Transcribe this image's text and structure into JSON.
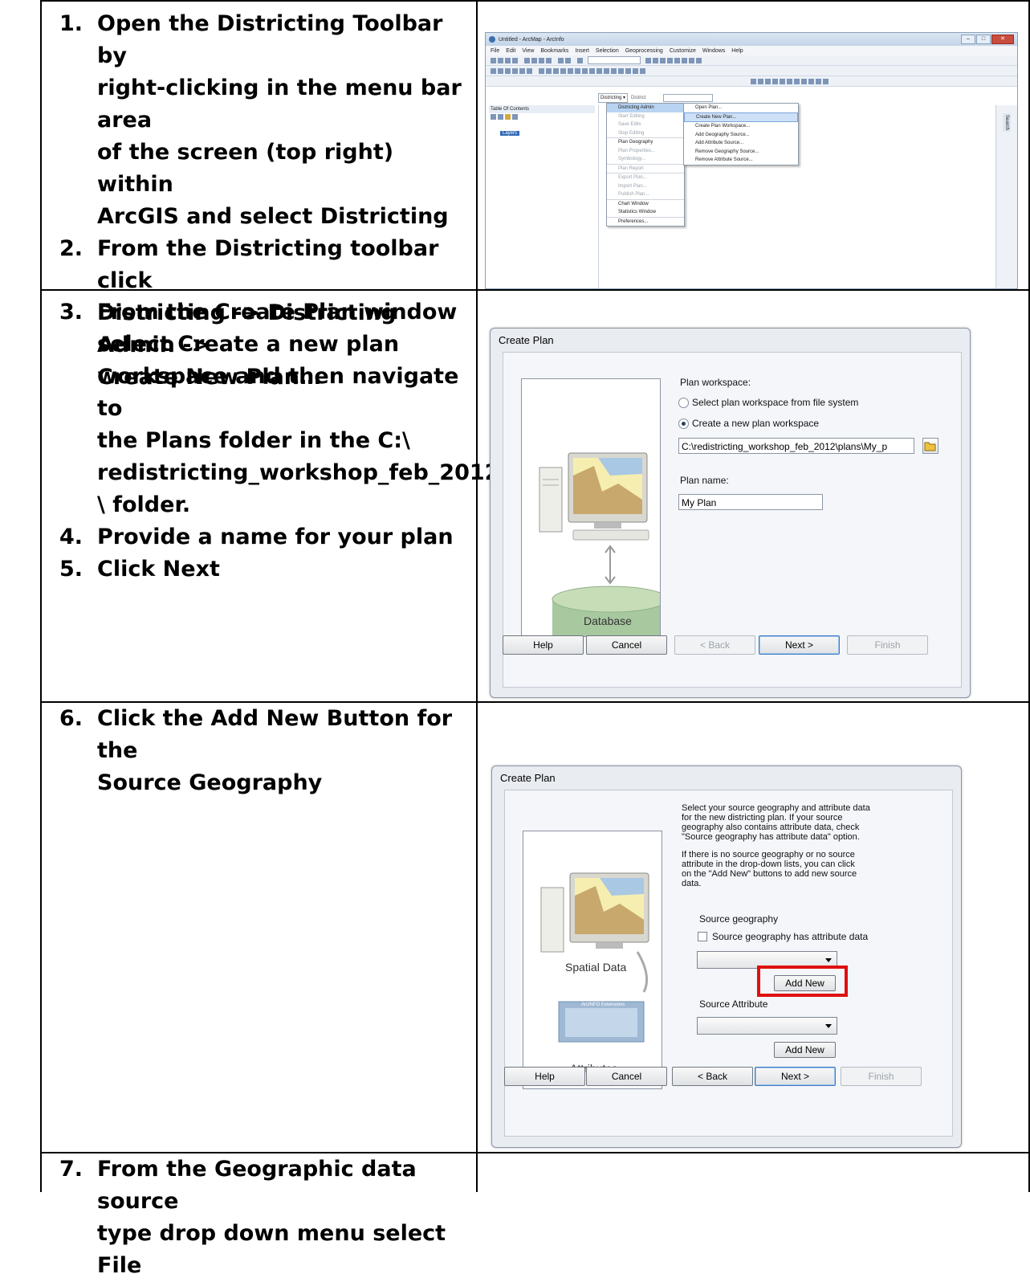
{
  "steps": [
    {
      "num": "1.",
      "lines": [
        "Open the Districting Toolbar by",
        "right-clicking in the menu bar area",
        "of the screen (top right) within",
        "ArcGIS and select Districting"
      ]
    },
    {
      "num": "2.",
      "lines": [
        "From the Districting toolbar click",
        "Districting -> Districting Admin ->",
        "Create New Plan…"
      ]
    },
    {
      "num": "3.",
      "lines": [
        "From the Create Plan window",
        "select Create a new plan",
        "workspace and then navigate to",
        "the Plans folder in the C:\\",
        "redistricting_workshop_feb_2012",
        "\\ folder."
      ]
    },
    {
      "num": "4.",
      "lines": [
        "Provide a name for your plan"
      ]
    },
    {
      "num": "5.",
      "lines": [
        "Click Next"
      ]
    },
    {
      "num": "6.",
      "lines": [
        "Click the Add New Button for the",
        "Source Geography"
      ]
    },
    {
      "num": "7.",
      "lines": [
        "From the Geographic data source",
        "type drop down menu select File"
      ]
    }
  ],
  "arcmap": {
    "title": "Untitled - ArcMap - ArcInfo",
    "menubar": [
      "File",
      "Edit",
      "View",
      "Bookmarks",
      "Insert",
      "Selection",
      "Geoprocessing",
      "Customize",
      "Windows",
      "Help"
    ],
    "districting_button": "Districting ▾",
    "district_label": "District",
    "toc_title": "Table Of Contents",
    "layers": "Layers",
    "search_tab": "Search",
    "menu_main": [
      "Districting Admin",
      "Start Editing",
      "Save Edits",
      "Stop Editing",
      "Plan Geography",
      "Plan Properties...",
      "Symbology...",
      "Plan Report",
      "Export Plan...",
      "Import Plan...",
      "Publish Plan...",
      "Chart Window",
      "Statistics Window",
      "Preferences..."
    ],
    "menu_admin": [
      "Open Plan...",
      "Create New Plan...",
      "Create Plan Workspace...",
      "Add Geography Source...",
      "Add Attribute Source...",
      "Remove Geography Source...",
      "Remove Attribute Source..."
    ]
  },
  "dialog1": {
    "title": "Create Plan",
    "workspace_label": "Plan workspace:",
    "radio_select": "Select plan workspace from file system",
    "radio_create": "Create a new plan workspace",
    "path_value": "C:\\redistricting_workshop_feb_2012\\plans\\My_p",
    "plan_name_label": "Plan name:",
    "plan_name_value": "My Plan",
    "database_label": "Database",
    "buttons": {
      "help": "Help",
      "cancel": "Cancel",
      "back": "< Back",
      "next": "Next >",
      "finish": "Finish"
    }
  },
  "dialog2": {
    "title": "Create Plan",
    "para1": [
      "Select your source geography and attribute data",
      "for the new districting plan. If your source",
      "geography also contains attribute data, check",
      "\"Source geography has attribute data\" option."
    ],
    "para2": [
      "If there is no source geography or no source",
      "attribute in the drop-down lists, you can click",
      "on the \"Add New\" buttons to add new source",
      "data."
    ],
    "source_geography_label": "Source geography",
    "checkbox_label": "Source geography has attribute data",
    "add_new": "Add New",
    "source_attribute_label": "Source Attribute",
    "spatial_data_label": "Spatial Data",
    "attributes_label": "Attributes",
    "arcinfo_label": "ArcINFO Extensions",
    "buttons": {
      "help": "Help",
      "cancel": "Cancel",
      "back": "< Back",
      "next": "Next >",
      "finish": "Finish"
    }
  },
  "colors": {
    "highlight_red": "#e01010",
    "menu_highlight": "#b8d4f2",
    "dialog_bg": "#e9ecf1"
  }
}
